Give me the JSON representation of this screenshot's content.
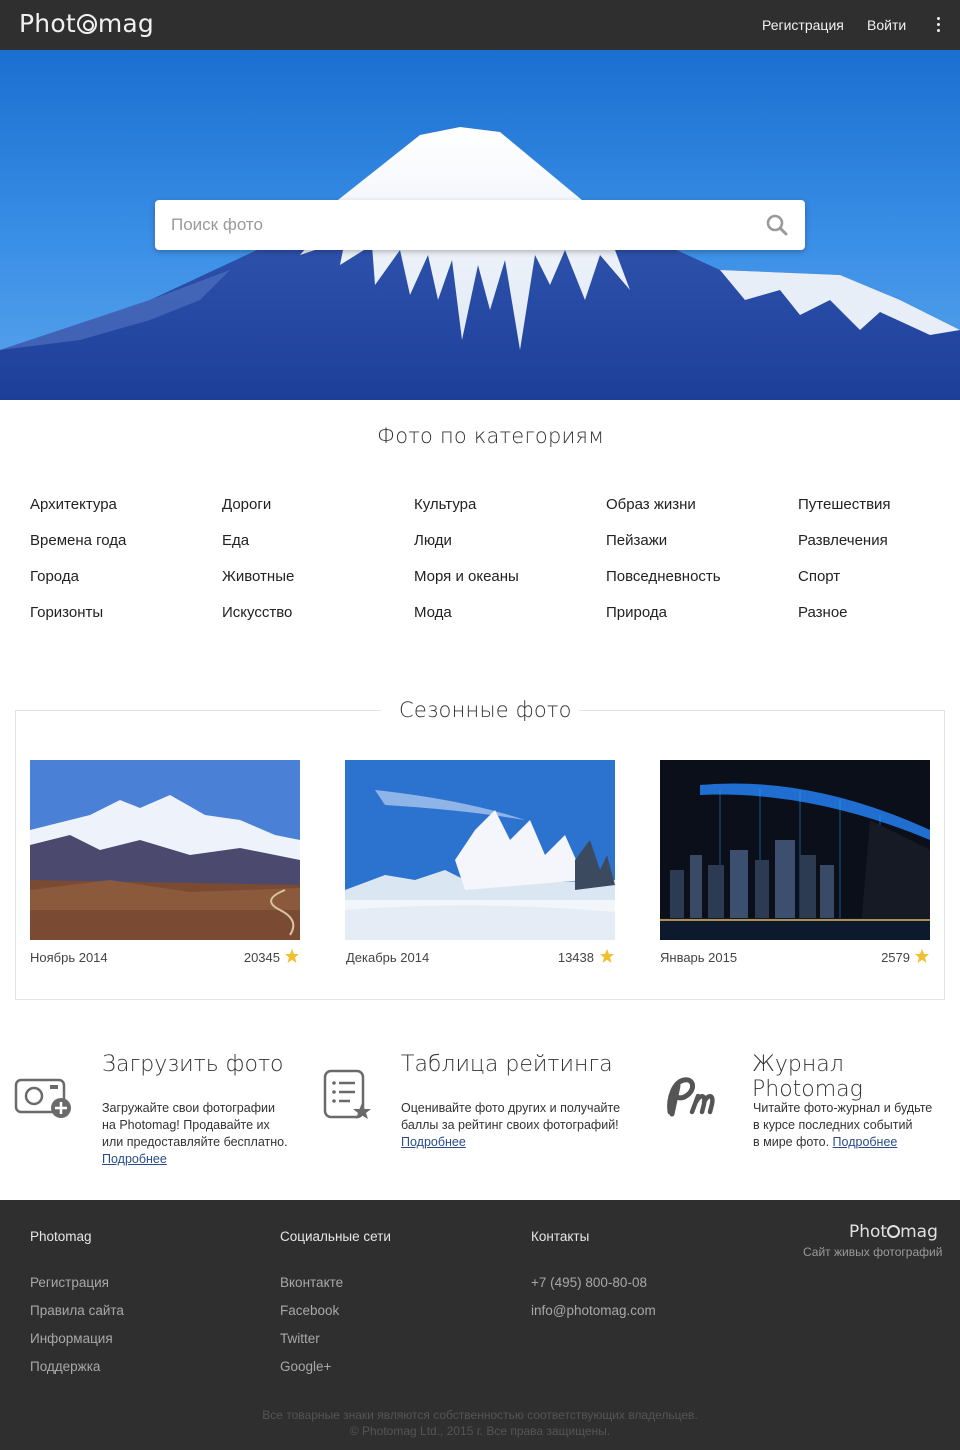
{
  "header": {
    "logo_text_1": "Phot",
    "logo_text_2": "mag",
    "register": "Регистрация",
    "login": "Войти"
  },
  "search": {
    "placeholder": "Поиск фото"
  },
  "categories": {
    "title": "Фото по категориям",
    "columns": [
      [
        "Архитектура",
        "Времена года",
        "Города",
        "Горизонты"
      ],
      [
        "Дороги",
        "Еда",
        "Животные",
        "Искусство"
      ],
      [
        "Культура",
        "Люди",
        "Моря и океаны",
        "Мода"
      ],
      [
        "Образ жизни",
        "Пейзажи",
        "Повседневность",
        "Природа"
      ],
      [
        "Путешествия",
        "Развлечения",
        "Спорт",
        "Разное"
      ]
    ]
  },
  "seasonal": {
    "title": "Сезонные фото",
    "photos": [
      {
        "caption": "Ноябрь 2014",
        "count": "20345"
      },
      {
        "caption": "Декабрь 2014",
        "count": "13438"
      },
      {
        "caption": "Январь 2015",
        "count": "2579"
      }
    ]
  },
  "features": [
    {
      "title": "Загрузить фото",
      "text": [
        "Загружайте свои фотографии",
        "на Photomag! Продавайте их",
        "или предоставляйте бесплатно."
      ],
      "link": "Подробнее"
    },
    {
      "title": "Таблица рейтинга",
      "text": [
        "Оценивайте фото других и получайте",
        "баллы за рейтинг своих фотографий!"
      ],
      "link": "Подробнее"
    },
    {
      "title": "Журнал Photomag",
      "text": [
        "Читайте фото-журнал и будьте",
        "в курсе последних событий",
        "в мире фото."
      ],
      "link": "Подробнее"
    }
  ],
  "footer": {
    "col1": {
      "head": "Photomag",
      "links": [
        "Регистрация",
        "Правила сайта",
        "Информация",
        "Поддержка"
      ]
    },
    "col2": {
      "head": "Социальные сети",
      "links": [
        "Вконтакте",
        "Facebook",
        "Twitter",
        "Google+"
      ]
    },
    "col3": {
      "head": "Контакты",
      "links": [
        "+7 (495) 800-80-08",
        "info@photomag.com"
      ]
    },
    "logo_1": "Phot",
    "logo_2": "mag",
    "tagline": "Сайт живых фотографий",
    "legal_1": "Все товарные знаки являются собственностью соответствующих владельцев.",
    "legal_2": "© Photomag Ltd., 2015 г. Все права защищены."
  },
  "colors": {
    "topbar": "#2f2f2f",
    "footer": "#2f2f2f",
    "star": "#f0c030",
    "link": "#2a4b8a"
  }
}
